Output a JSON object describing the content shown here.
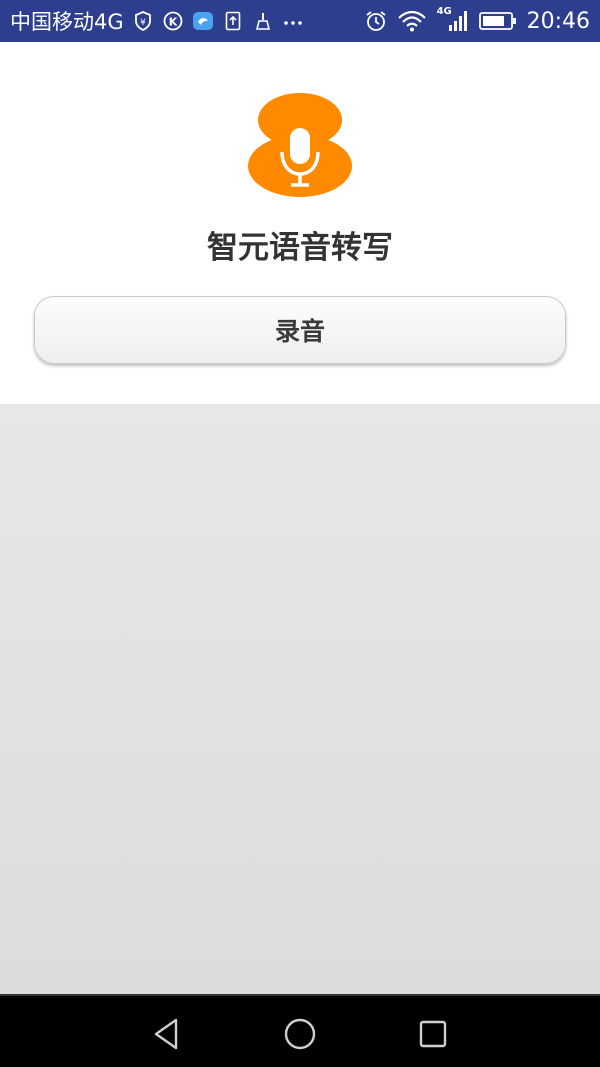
{
  "status_bar": {
    "carrier": "中国移动4G",
    "time": "20:46",
    "network_label": "4G",
    "left_icons": [
      "shield-yen-icon",
      "k-icon",
      "bird-app-icon",
      "upload-icon",
      "broom-icon",
      "more-dots-icon"
    ],
    "right_icons": [
      "alarm-icon",
      "wifi-icon",
      "signal-icon",
      "battery-icon"
    ]
  },
  "app": {
    "title": "智元语音转写",
    "logo_icon": "microphone-logo-icon",
    "brand_color": "#ff8a00"
  },
  "record_button": {
    "label": "录音"
  },
  "nav_bar": {
    "buttons": [
      "back-icon",
      "home-icon",
      "recents-icon"
    ]
  },
  "colors": {
    "status_bar": "#2d3e8e",
    "content_bg": "#e2e2e2",
    "title_text": "#333333"
  }
}
